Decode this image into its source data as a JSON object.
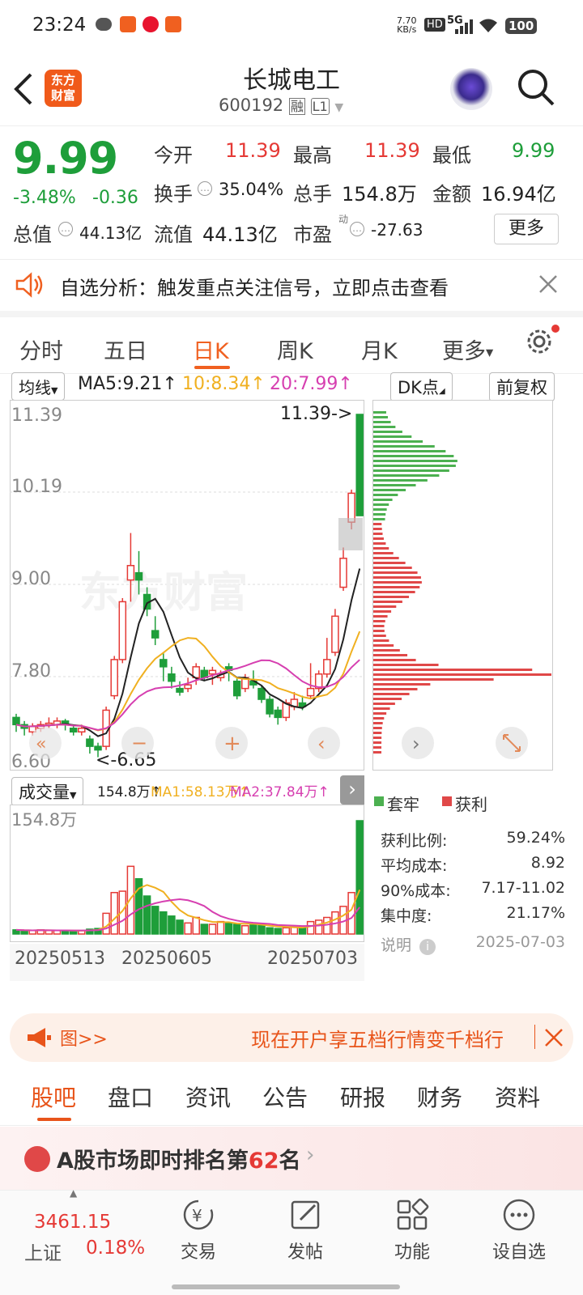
{
  "status": {
    "time": "23:24",
    "speed_top": "7.70",
    "speed_unit": "KB/s",
    "hd": "HD",
    "net": "5G",
    "battery": "100"
  },
  "header": {
    "logo_line1": "东方",
    "logo_line2": "财富",
    "title": "长城电工",
    "code": "600192",
    "tag_rong": "融",
    "tag_level": "L1"
  },
  "quote": {
    "price": "9.99",
    "change_pct": "-3.48%",
    "change_amt": "-0.36",
    "open_label": "今开",
    "open": "11.39",
    "high_label": "最高",
    "high": "11.39",
    "low_label": "最低",
    "low": "9.99",
    "turnover_label": "换手",
    "turnover": "35.04%",
    "volume_label": "总手",
    "volume": "154.8万",
    "amount_label": "金额",
    "amount": "16.94亿",
    "mktcap_label": "总值",
    "mktcap": "44.13亿",
    "float_label": "流值",
    "float": "44.13亿",
    "pe_label": "市盈",
    "pe_sup": "动",
    "pe": "-27.63",
    "more_button": "更多"
  },
  "notice": {
    "text": "自选分析：触发重点关注信号，立即点击查看"
  },
  "ktabs": [
    "分时",
    "五日",
    "日K",
    "周K",
    "月K",
    "更多"
  ],
  "chart": {
    "ma_select": "均线",
    "ma5": "MA5:9.21",
    "ma10": "10:8.34",
    "ma20": "20:7.99",
    "dk_button": "DK点",
    "fq_button": "前复权",
    "price_ticks": [
      "11.39",
      "10.19",
      "9.00",
      "7.80",
      "6.60"
    ],
    "max_label": "11.39->",
    "min_label": "<-6.65",
    "watermark": "东方财富",
    "vol_select": "成交量",
    "vol_value": "154.8万",
    "vol_ma1": "MA1:58.13万",
    "vol_ma2": "MA2:37.84万",
    "vol_max": "154.8万",
    "dates": [
      "20250513",
      "20250605",
      "20250703"
    ],
    "colors": {
      "up": "#e53935",
      "down": "#1e9e3a",
      "ma5": "#222222",
      "ma10": "#f0b020",
      "ma20": "#d63fb0"
    }
  },
  "chip": {
    "legend_trapped": "套牢",
    "legend_profit": "获利",
    "rows": [
      {
        "label": "获利比例:",
        "value": "59.24%"
      },
      {
        "label": "平均成本:",
        "value": "8.92"
      },
      {
        "label": "90%成本:",
        "value": "7.17-11.02"
      },
      {
        "label": "集中度:",
        "value": "21.17%"
      }
    ],
    "note_label": "说明",
    "date": "2025-07-03"
  },
  "banner": {
    "left": "图>>",
    "text": "现在开户享五档行情变千档行"
  },
  "subtabs": [
    "股吧",
    "盘口",
    "资讯",
    "公告",
    "研报",
    "财务",
    "资料"
  ],
  "rank": {
    "prefix": "A股市场即时排名第",
    "rank": "62",
    "suffix": "名"
  },
  "index": {
    "value": "3461.15",
    "name": "上证",
    "pct": "0.18%"
  },
  "nav": [
    "交易",
    "发帖",
    "功能",
    "设自选"
  ]
}
